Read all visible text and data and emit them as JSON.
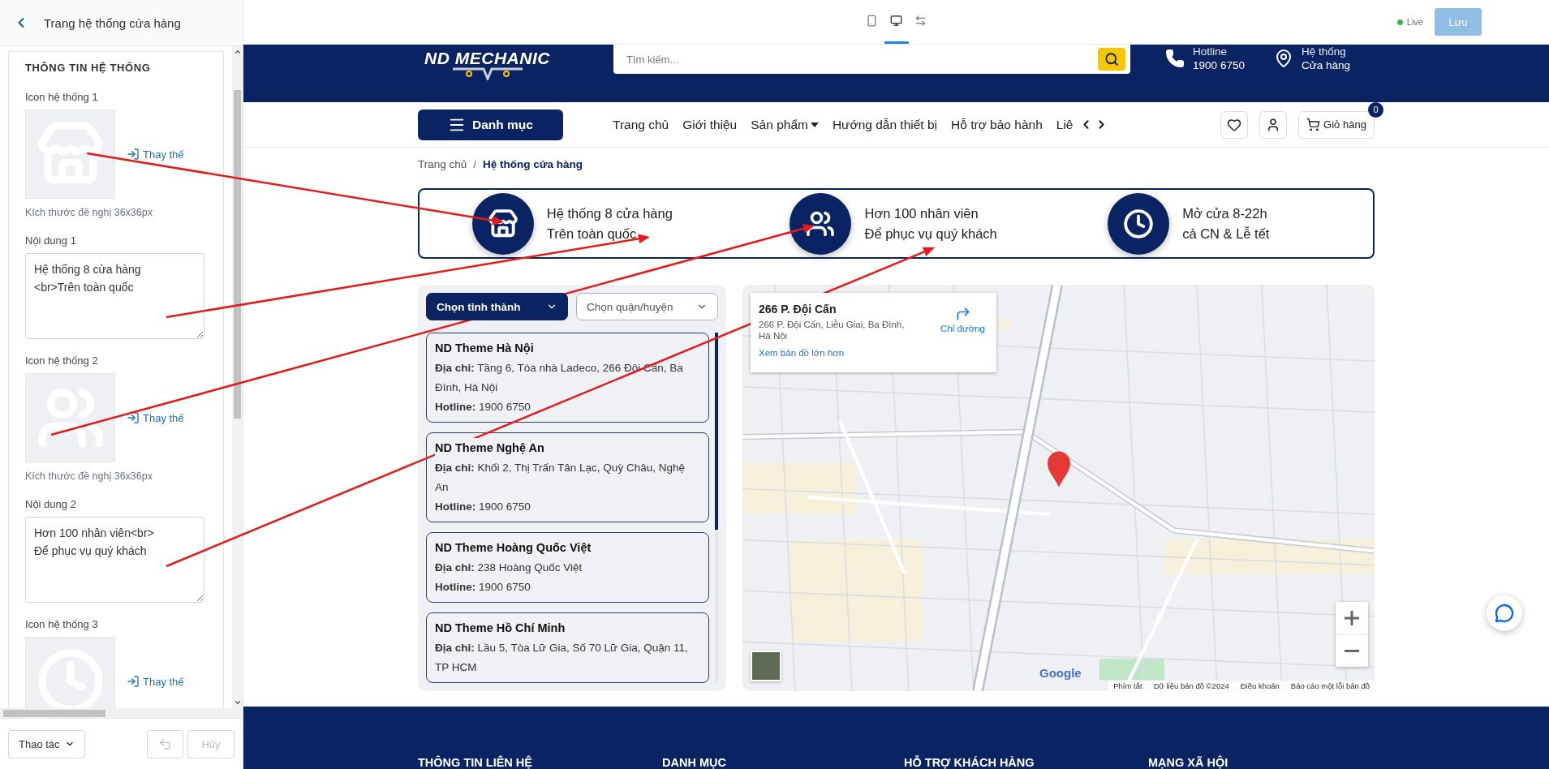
{
  "editor": {
    "title": "Trang hệ thống cửa hàng",
    "section_title": "THÔNG TIN HỆ THỐNG",
    "fields": [
      {
        "kind": "image",
        "label": "Icon hệ thống 1",
        "action": "Thay thế",
        "hint": "Kích thước đề nghị 36x36px"
      },
      {
        "kind": "textarea",
        "label": "Nội dung 1",
        "value": "Hệ thống 8 cửa hàng\n<br>Trên toàn quốc"
      },
      {
        "kind": "image",
        "label": "Icon hệ thống 2",
        "action": "Thay thế",
        "hint": "Kích thước đề nghị 36x36px"
      },
      {
        "kind": "textarea",
        "label": "Nội dung 2",
        "value": "Hơn 100 nhân viên<br>\nĐể phục vụ quý khách"
      },
      {
        "kind": "image",
        "label": "Icon hệ thống 3",
        "action": "Thay thế"
      }
    ],
    "actions_menu": "Thao tác",
    "undo": {
      "disabled": true
    },
    "cancel": {
      "label": "Hủy",
      "disabled": true
    }
  },
  "toolbar": {
    "devices": [
      {
        "selected": false
      },
      {
        "selected": true
      },
      {
        "selected": false
      }
    ],
    "status": "Live",
    "save": {
      "label": "Lưu",
      "disabled": true
    }
  },
  "site": {
    "header": {
      "logo": "ND MECHANIC",
      "search": {
        "placeholder": "Tìm kiếm..."
      },
      "contacts": [
        {
          "label": "Hotline",
          "value": "1900 6750"
        },
        {
          "label": "Hệ thống",
          "value": "Cửa hàng"
        }
      ]
    },
    "nav": {
      "menu_button": "Danh mục",
      "links": [
        {
          "kind": "link",
          "label": "Trang chủ"
        },
        {
          "kind": "link",
          "label": "Giới thiệu"
        },
        {
          "kind": "dropdown",
          "label": "Sản phẩm"
        },
        {
          "kind": "link",
          "label": "Hướng dẫn thiết bị"
        },
        {
          "kind": "link",
          "label": "Hỗ trợ bảo hành"
        },
        {
          "kind": "link",
          "label": "Liê"
        }
      ],
      "cart": {
        "label": "Giỏ hàng",
        "count": "0"
      }
    },
    "breadcrumb": {
      "items": [
        "Trang chủ",
        "Hệ thống cửa hàng"
      ],
      "separator": "/"
    },
    "features": [
      {
        "line1": "Hệ thống 8 cửa hàng",
        "line2": "Trên toàn quốc"
      },
      {
        "line1": "Hơn 100 nhân viên",
        "line2": "Để phục vụ quý khách"
      },
      {
        "line1": "Mở cửa 8-22h",
        "line2": "cả CN & Lễ tết"
      }
    ],
    "stores": {
      "filters": [
        {
          "label": "Chọn tỉnh thành",
          "active": true
        },
        {
          "label": "Chọn quận/huyện",
          "active": false
        }
      ],
      "list": [
        {
          "name": "ND Theme Hà Nội",
          "address_label": "Địa chỉ:",
          "address": "Tầng 6, Tòa nhà Ladeco, 266 Đội Cấn, Ba Đình, Hà Nội",
          "hotline_label": "Hotline:",
          "hotline": "1900 6750"
        },
        {
          "name": "ND Theme Nghệ An",
          "address_label": "Địa chỉ:",
          "address": "Khối 2, Thị Trấn Tân Lạc, Quỳ Châu, Nghệ An",
          "hotline_label": "Hotline:",
          "hotline": "1900 6750"
        },
        {
          "name": "ND Theme Hoàng Quốc Việt",
          "address_label": "Địa chỉ:",
          "address": "238 Hoàng Quốc Việt",
          "hotline_label": "Hotline:",
          "hotline": "1900 6750"
        },
        {
          "name": "ND Theme Hồ Chí Minh",
          "address_label": "Địa chỉ:",
          "address": "Lầu 5, Tòa Lữ Gia, Số 70 Lữ Gia, Quận 11, TP HCM"
        }
      ]
    },
    "map": {
      "card": {
        "title": "266 P. Đội Cấn",
        "address": "266 P. Đội Cấn, Liễu Giai, Ba Đình, Hà Nội",
        "directions": "Chỉ đường",
        "link": "Xem bản đồ lớn hơn"
      },
      "logo": "Google",
      "attribution": [
        "Phím tắt",
        "Dữ liệu bản đồ ©2024",
        "Điều khoản",
        "Báo cáo một lỗi bản đồ"
      ]
    },
    "footer": {
      "headings": [
        "THÔNG TIN LIÊN HỆ",
        "DANH MỤC",
        "HỖ TRỢ KHÁCH HÀNG",
        "MẠNG XÃ HỘI"
      ]
    }
  }
}
